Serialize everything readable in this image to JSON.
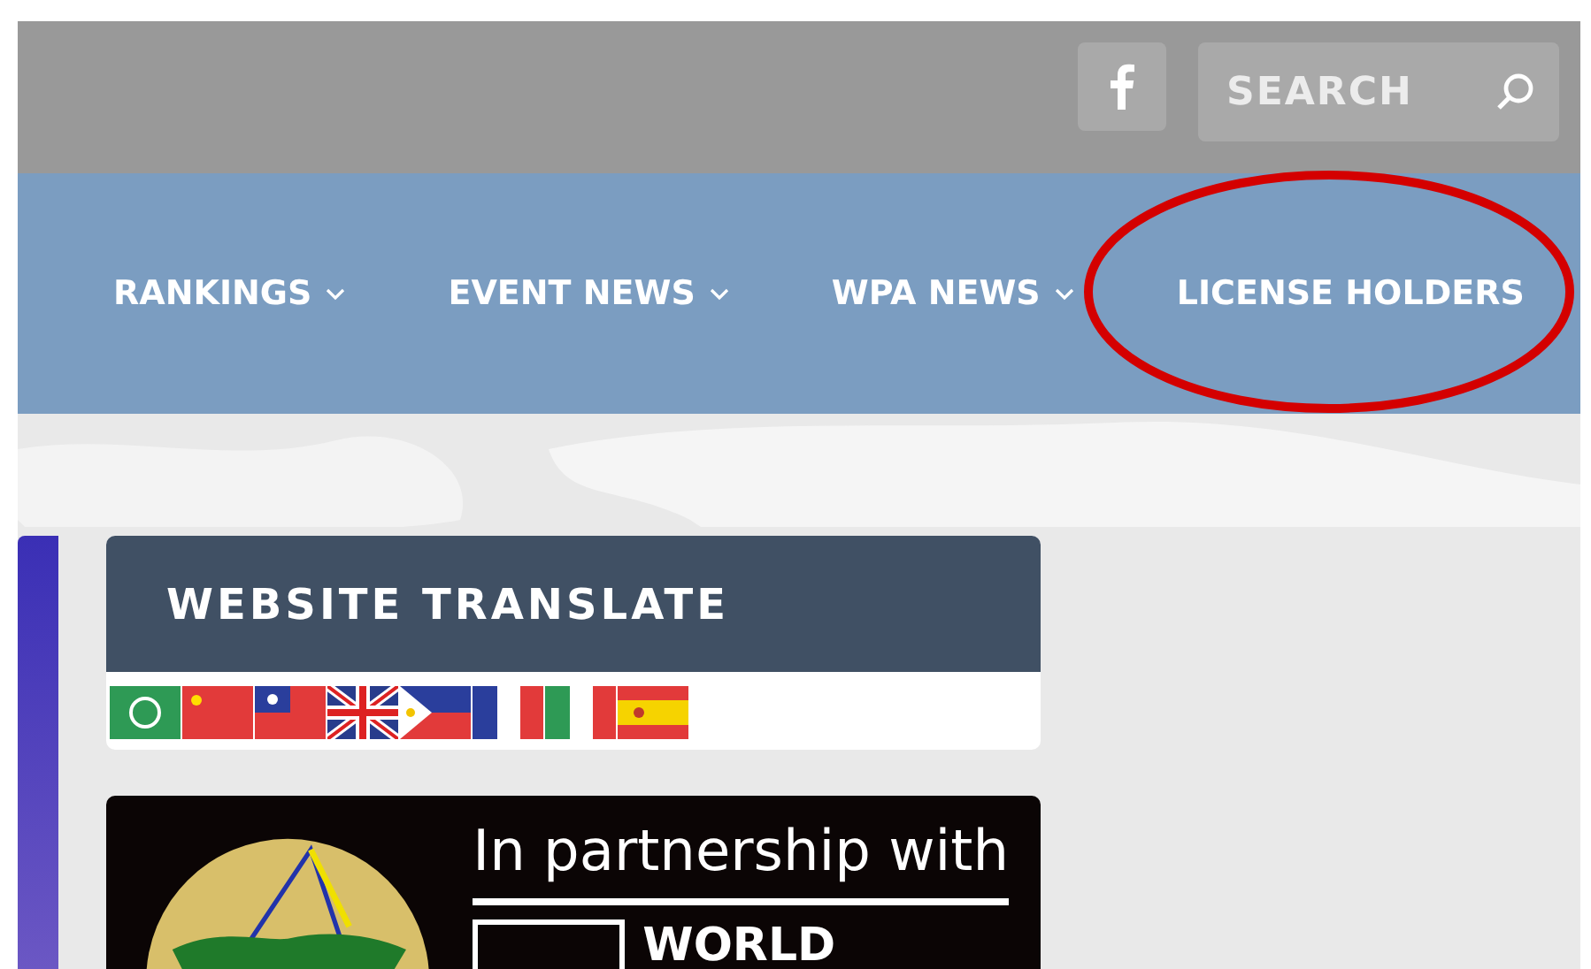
{
  "top_bar": {
    "search": {
      "placeholder": "SEARCH"
    }
  },
  "nav": [
    {
      "label": "RANKINGS",
      "dropdown": true,
      "circled": false
    },
    {
      "label": "EVENT NEWS",
      "dropdown": true,
      "circled": false
    },
    {
      "label": "WPA NEWS",
      "dropdown": true,
      "circled": false
    },
    {
      "label": "LICENSE HOLDERS",
      "dropdown": false,
      "circled": true
    }
  ],
  "translate_widget": {
    "title": "WEBSITE TRANSLATE",
    "flags": [
      {
        "kind": "arabic"
      },
      {
        "kind": "chinese"
      },
      {
        "kind": "taiwanese"
      },
      {
        "kind": "english"
      },
      {
        "kind": "filipino"
      },
      {
        "kind": "french"
      },
      {
        "kind": "italian"
      },
      {
        "kind": "spanish"
      }
    ]
  },
  "partner_banner": {
    "heading": "In partnership with",
    "name": "WORLD"
  }
}
